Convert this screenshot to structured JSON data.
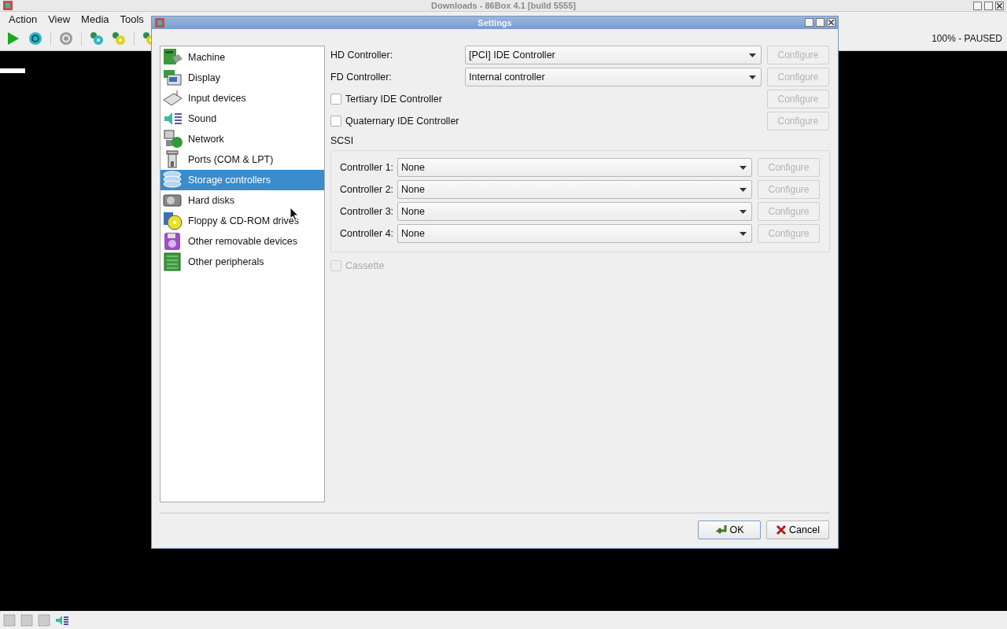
{
  "main_window": {
    "title": "Downloads - 86Box 4.1 [build 5555]",
    "menu": [
      "Action",
      "View",
      "Media",
      "Tools"
    ],
    "status": "100% - PAUSED"
  },
  "dialog": {
    "title": "Settings",
    "sidebar": [
      {
        "label": "Machine",
        "selected": false
      },
      {
        "label": "Display",
        "selected": false
      },
      {
        "label": "Input devices",
        "selected": false
      },
      {
        "label": "Sound",
        "selected": false
      },
      {
        "label": "Network",
        "selected": false
      },
      {
        "label": "Ports (COM & LPT)",
        "selected": false
      },
      {
        "label": "Storage controllers",
        "selected": true
      },
      {
        "label": "Hard disks",
        "selected": false
      },
      {
        "label": "Floppy & CD-ROM drives",
        "selected": false
      },
      {
        "label": "Other removable devices",
        "selected": false
      },
      {
        "label": "Other peripherals",
        "selected": false
      }
    ],
    "rows": [
      {
        "kind": "select",
        "label": "HD Controller:",
        "value": "[PCI] IDE Controller",
        "button": "Configure",
        "button_disabled": true
      },
      {
        "kind": "select",
        "label": "FD Controller:",
        "value": "Internal controller",
        "button": "Configure",
        "button_disabled": true
      },
      {
        "kind": "checkbox",
        "label": "Tertiary IDE Controller",
        "checked": false,
        "button": "Configure",
        "button_disabled": true
      },
      {
        "kind": "checkbox",
        "label": "Quaternary IDE Controller",
        "checked": false,
        "button": "Configure",
        "button_disabled": true
      }
    ],
    "scsi": {
      "title": "SCSI",
      "controllers": [
        {
          "label": "Controller 1:",
          "value": "None",
          "button": "Configure",
          "button_disabled": true
        },
        {
          "label": "Controller 2:",
          "value": "None",
          "button": "Configure",
          "button_disabled": true
        },
        {
          "label": "Controller 3:",
          "value": "None",
          "button": "Configure",
          "button_disabled": true
        },
        {
          "label": "Controller 4:",
          "value": "None",
          "button": "Configure",
          "button_disabled": true
        }
      ]
    },
    "cassette": {
      "label": "Cassette",
      "checked": false,
      "disabled": true
    },
    "buttons": [
      {
        "label": "OK",
        "kind": "ok"
      },
      {
        "label": "Cancel",
        "kind": "cancel"
      }
    ]
  }
}
